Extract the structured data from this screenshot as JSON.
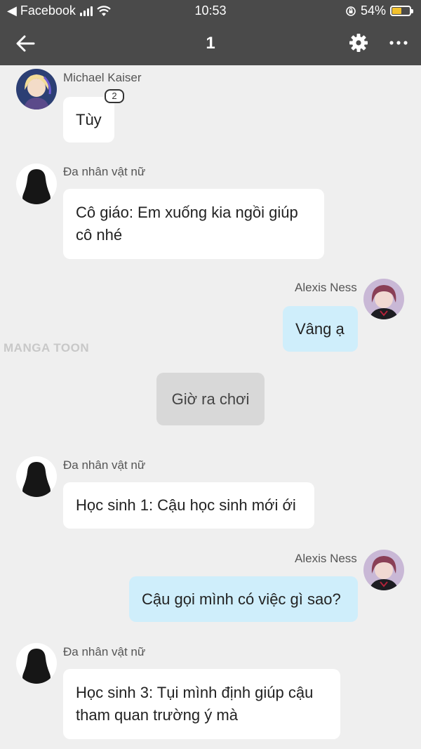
{
  "status_bar": {
    "back_app": "◀ Facebook",
    "time": "10:53",
    "battery": "54%",
    "battery_level": 0.54,
    "battery_color": "#f2c12e"
  },
  "nav": {
    "title": "1",
    "icons": [
      "arrow-left-icon",
      "gear-icon",
      "more-icon"
    ]
  },
  "watermark": "MANGA TOON",
  "messages": [
    {
      "sender": "Michael Kaiser",
      "text": "Tùy",
      "badge": "2"
    },
    {
      "sender": "Đa nhân vật nữ",
      "text": "Cô giáo: Em xuống kia ngồi giúp cô nhé"
    },
    {
      "sender": "Alexis Ness",
      "text": "Vâng ạ"
    },
    {
      "text": "Giờ ra chơi"
    },
    {
      "sender": "Đa nhân vật nữ",
      "text": "Học sinh 1: Cậu học sinh mới ới"
    },
    {
      "sender": "Alexis Ness",
      "text": "Cậu gọi mình có việc gì sao?"
    },
    {
      "sender": "Đa nhân vật nữ",
      "text": "Học sinh 3: Tụi mình định giúp cậu tham quan trường ý mà"
    }
  ],
  "colors": {
    "header": "#4a4a4a",
    "background": "#efefef",
    "outgoing_bubble": "#cfeefb",
    "narration_bubble": "#d8d8d8"
  }
}
